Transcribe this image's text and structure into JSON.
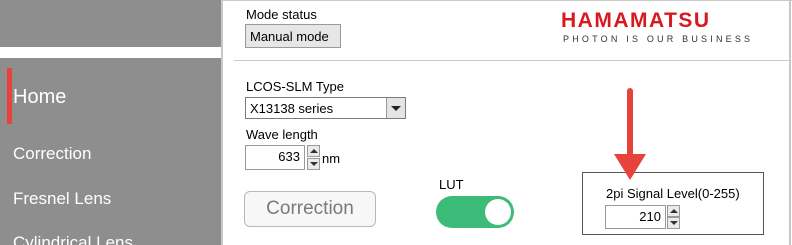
{
  "sidebar": {
    "items": [
      {
        "label": "Home",
        "active": true
      },
      {
        "label": "Correction"
      },
      {
        "label": "Fresnel Lens"
      },
      {
        "label": "Cylindrical Lens"
      }
    ]
  },
  "mode": {
    "label": "Mode status",
    "value": "Manual mode"
  },
  "logo": {
    "name": "HAMAMATSU",
    "tagline": "PHOTON IS OUR BUSINESS"
  },
  "slm": {
    "label": "LCOS-SLM Type",
    "selected": "X13138 series"
  },
  "wave": {
    "label": "Wave length",
    "value": "633",
    "unit": "nm"
  },
  "correction_button": {
    "label": "Correction"
  },
  "lut": {
    "label": "LUT",
    "state": "on"
  },
  "signal_level": {
    "label": "2pi Signal Level(0-255)",
    "value": "210"
  },
  "annotation": {
    "arrow_icon": "down-arrow-icon",
    "color": "#e8433a"
  },
  "colors": {
    "accent_red": "#e8433a",
    "toggle_green": "#3dbb78",
    "brand_red": "#d71920"
  }
}
